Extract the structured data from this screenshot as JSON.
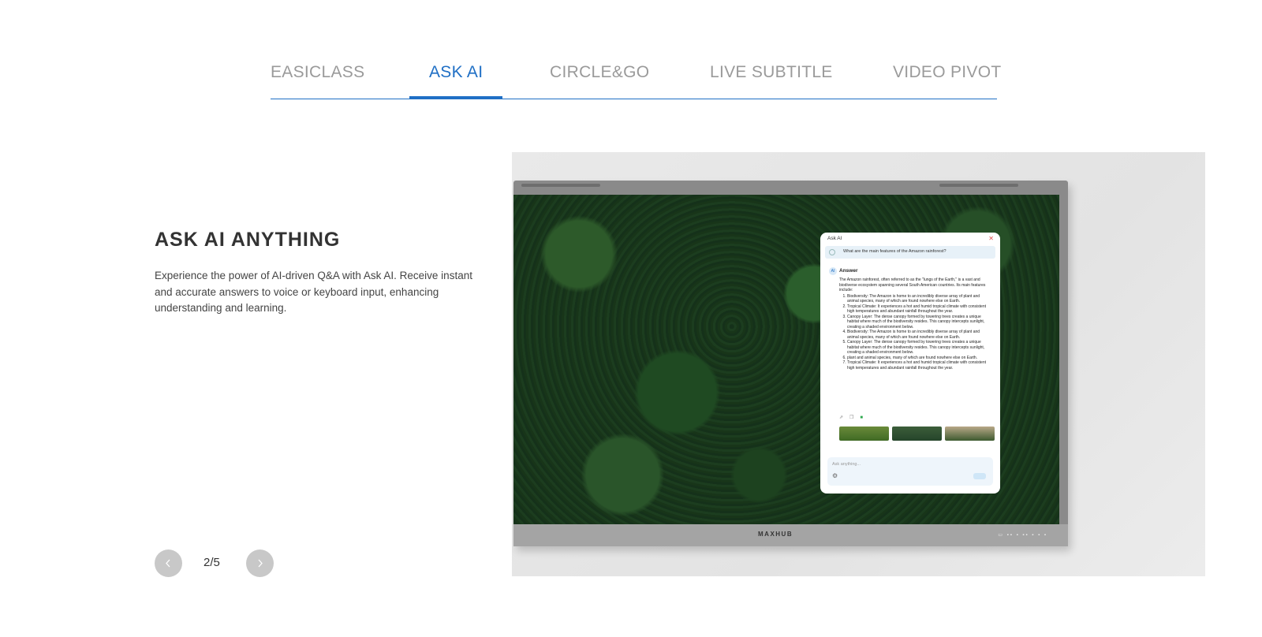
{
  "tabs": [
    {
      "label": "EASICLASS",
      "active": false
    },
    {
      "label": "ASK AI",
      "active": true
    },
    {
      "label": "CIRCLE&GO",
      "active": false
    },
    {
      "label": "LIVE SUBTITLE",
      "active": false
    },
    {
      "label": "VIDEO PIVOT",
      "active": false
    }
  ],
  "feature": {
    "title": "ASK AI ANYTHING",
    "description": "Experience the power of AI-driven Q&A with Ask AI. Receive instant and accurate answers to voice or keyboard input, enhancing understanding and learning."
  },
  "pager": {
    "counter": "2/5",
    "prev_icon": "chevron-left-icon",
    "next_icon": "chevron-right-icon"
  },
  "device": {
    "brand": "MAXHUB"
  },
  "ask_ai_window": {
    "title": "Ask AI",
    "question": "What are the main features of the Amazon rainforest?",
    "answer_label": "Answer",
    "answer_intro": "The Amazon rainforest, often referred to as the \"lungs of the Earth,\" is a vast and biodiverse ecosystem spanning several South American countries. Its main features include:",
    "answer_items": [
      "Biodiversity: The Amazon is home to an incredibly diverse array of plant and animal species, many of which are found nowhere else on Earth.",
      "Tropical Climate: It experiences a hot and humid tropical climate with consistent high temperatures and abundant rainfall throughout the year.",
      "Canopy Layer: The dense canopy formed by towering trees creates a unique habitat where much of the biodiversity resides. This canopy intercepts sunlight, creating a shaded environment below.",
      "Biodiversity: The Amazon is home to an incredibly diverse array of plant and animal species, many of which are found nowhere else on Earth.",
      "Canopy Layer: The dense canopy formed by towering trees creates a unique habitat where much of the biodiversity resides. This canopy intercepts sunlight, creating a shaded environment below.",
      "plant and animal species, many of which are found nowhere else on Earth.",
      "Tropical Climate: It experiences a hot and humid tropical climate with consistent high temperatures and abundant rainfall throughout the year."
    ],
    "input_placeholder": "Ask anything..."
  },
  "colors": {
    "accent": "#1f6fc5",
    "tab_inactive": "#9a9a9a",
    "pager_button": "#c8c8c8"
  }
}
